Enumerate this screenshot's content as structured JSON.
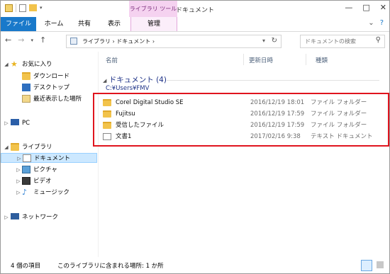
{
  "window": {
    "title": "ドキュメント",
    "context_tab_group": "ライブラリ ツール",
    "controls": [
      "—",
      "□",
      "✕"
    ]
  },
  "ribbon": {
    "tabs": [
      {
        "label": "ファイル",
        "active": true
      },
      {
        "label": "ホーム"
      },
      {
        "label": "共有"
      },
      {
        "label": "表示"
      },
      {
        "label": "管理"
      }
    ]
  },
  "address": {
    "path": "ライブラリ › ドキュメント ›",
    "segments": [
      "ライブラリ",
      "ドキュメント"
    ],
    "search_placeholder": "ドキュメントの検索"
  },
  "nav_pane": {
    "items": [
      {
        "label": "お気に入り",
        "icon": "star-icon"
      },
      {
        "label": "ダウンロード",
        "icon": "downloads-icon"
      },
      {
        "label": "デスクトップ",
        "icon": "desktop-icon"
      },
      {
        "label": "最近表示した場所",
        "icon": "recent-places-icon"
      },
      {
        "label": "PC",
        "icon": "pc-icon"
      },
      {
        "label": "ライブラリ",
        "icon": "library-icon"
      },
      {
        "label": "ドキュメント",
        "icon": "documents-icon",
        "selected": true
      },
      {
        "label": "ピクチャ",
        "icon": "pictures-icon"
      },
      {
        "label": "ビデオ",
        "icon": "videos-icon"
      },
      {
        "label": "ミュージック",
        "icon": "music-icon"
      },
      {
        "label": "ネットワーク",
        "icon": "network-icon"
      }
    ]
  },
  "columns": {
    "name": "名前",
    "date": "更新日時",
    "type": "種類"
  },
  "group": {
    "title": "ドキュメント (4)",
    "path": "C:¥Users¥FMV"
  },
  "files": [
    {
      "name": "Corel Digital Studio SE",
      "date": "2016/12/19 18:01",
      "type": "ファイル フォルダー",
      "icon": "folder-icon"
    },
    {
      "name": "Fujitsu",
      "date": "2016/12/19 17:59",
      "type": "ファイル フォルダー",
      "icon": "folder-icon"
    },
    {
      "name": "受信したファイル",
      "date": "2016/12/19 17:59",
      "type": "ファイル フォルダー",
      "icon": "folder-icon"
    },
    {
      "name": "文書1",
      "date": "2017/02/16 9:38",
      "type": "テキスト ドキュメント",
      "icon": "text-file-icon"
    }
  ],
  "status": {
    "count": "4 個の項目",
    "library_info": "このライブラリに含まれる場所: 1 か所"
  },
  "colors": {
    "file_tab": "#1979ca",
    "context_tab": "#f5d2f0",
    "highlight_box": "#e0141e",
    "selection": "#cce8ff"
  }
}
